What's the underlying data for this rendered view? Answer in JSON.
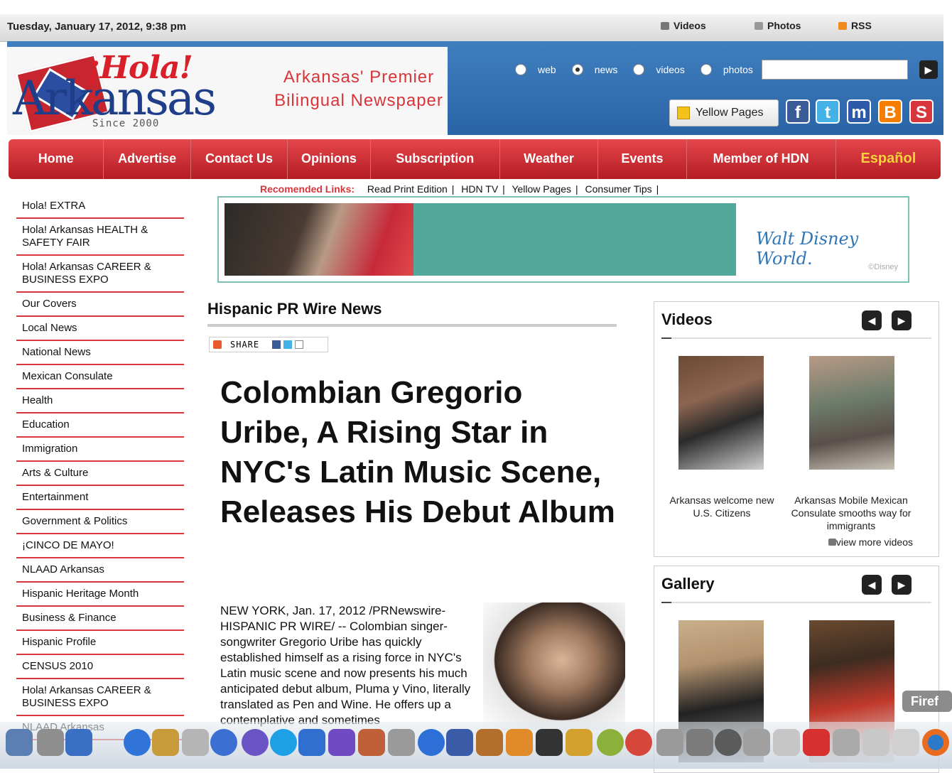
{
  "topbar": {
    "date": "Tuesday, January 17, 2012, 9:38 pm",
    "links": [
      {
        "label": "Videos",
        "icon": "video-icon"
      },
      {
        "label": "Photos",
        "icon": "camera-icon"
      },
      {
        "label": "RSS",
        "icon": "rss-icon"
      }
    ]
  },
  "header": {
    "logo_hola": "¡Hola!",
    "logo_name": "Arkansas",
    "logo_since": "Since 2000",
    "tagline_line1": "Arkansas' Premier",
    "tagline_line2": "Bilingual Newspaper",
    "search_options": [
      "web",
      "news",
      "videos",
      "photos"
    ],
    "search_selected": "news",
    "search_value": "",
    "yellow_pages_label": "Yellow Pages",
    "social_icons": [
      "facebook-icon",
      "twitter-icon",
      "myspace-icon",
      "blogger-icon",
      "stumbleupon-icon"
    ]
  },
  "nav": {
    "items": [
      "Home",
      "Advertise",
      "Contact Us",
      "Opinions",
      "Subscription",
      "Weather",
      "Events",
      "Member of HDN",
      "Español"
    ]
  },
  "sidebar": {
    "items": [
      "Hola! EXTRA",
      "Hola! Arkansas HEALTH & SAFETY FAIR",
      "Hola! Arkansas CAREER & BUSINESS EXPO",
      "Our Covers",
      "Local News",
      "National News",
      "Mexican Consulate",
      "Health",
      "Education",
      "Immigration",
      "Arts & Culture",
      "Entertainment",
      "Government & Politics",
      "¡CINCO DE MAYO!",
      "NLAAD Arkansas",
      "Hispanic Heritage Month",
      "Business & Finance",
      "Hispanic Profile",
      "CENSUS 2010",
      "Hola! Arkansas CAREER & BUSINESS EXPO",
      "NLAAD Arkansas"
    ]
  },
  "recommended": {
    "label": "Recomended Links:",
    "links": [
      "Read Print Edition",
      "HDN TV",
      "Yellow Pages",
      "Consumer Tips"
    ],
    "trailing": "|"
  },
  "banner": {
    "logo": "Walt Disney World.",
    "copyright": "©Disney"
  },
  "article": {
    "section_title": "Hispanic PR Wire News",
    "share_label": "SHARE",
    "headline": "Colombian Gregorio Uribe, A Rising Star in NYC's Latin Music Scene, Releases His Debut Album",
    "body": "NEW YORK, Jan. 17, 2012 /PRNewswire-HISPANIC PR WIRE/ -- Colombian singer-songwriter Gregorio Uribe has quickly established himself as a rising force in NYC's Latin music scene and now presents his much anticipated debut album, Pluma y Vino, literally translated as Pen and Wine. He offers up a contemplative and sometimes"
  },
  "videos": {
    "title": "Videos",
    "items": [
      {
        "caption": "Arkansas welcome new U.S. Citizens"
      },
      {
        "caption": "Arkansas Mobile Mexican Consulate smooths way for immigrants"
      }
    ],
    "view_more": "view more videos"
  },
  "gallery": {
    "title": "Gallery"
  },
  "dock": {
    "tooltip": "Firef"
  },
  "colors": {
    "nav_red": "#c8262e",
    "header_blue": "#2a64a6",
    "accent_red": "#d7363c",
    "espanol_yellow": "#f7d23a",
    "banner_teal": "#52a89a"
  }
}
